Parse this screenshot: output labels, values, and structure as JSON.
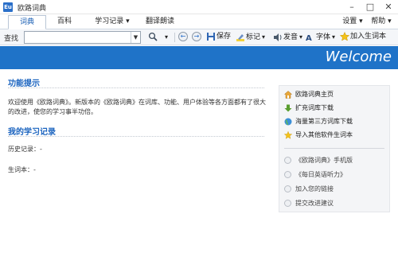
{
  "window": {
    "title": "欧路词典",
    "icon_text": "Eu",
    "min": "–",
    "max": "□",
    "close": "✕"
  },
  "tabs": {
    "dictionary": "词典",
    "encyclopedia": "百科",
    "study_record": "学习记录 ▾",
    "translate": "翻译朗读",
    "settings": "设置 ▾",
    "help": "帮助 ▾"
  },
  "toolbar": {
    "lookup_label": "查找",
    "search_value": "",
    "search_placeholder": "",
    "search_dropdown": "▼",
    "search_icon_dropdown": "▾",
    "back": "←",
    "forward": "→",
    "save": "保存",
    "mark": "标记",
    "mark_dropdown": "▾",
    "pronounce": "发音",
    "pronounce_dropdown": "▾",
    "font": "字体",
    "font_dropdown": "▾",
    "add_vocab": "加入生词本"
  },
  "banner": {
    "text": "Welcome"
  },
  "main": {
    "feature_title": "功能提示",
    "intro_text": "欢迎使用《欧路词典》。新版本的《欧路词典》在词库、功能、用户体验等各方面都有了很大的改进，使您的学习事半功倍。",
    "study_title": "我的学习记录",
    "history_label": "历史记录：-",
    "vocab_label": "生词本：-"
  },
  "side_panel": {
    "links": [
      {
        "label": "欧路词典主页",
        "icon": "home-icon"
      },
      {
        "label": "扩充词库下载",
        "icon": "download-arrow-icon"
      },
      {
        "label": "海量第三方词库下载",
        "icon": "globe-icon"
      },
      {
        "label": "导入其他软件生词本",
        "icon": "star-icon"
      }
    ],
    "items": [
      {
        "label": "《欧路词典》手机版"
      },
      {
        "label": "《每日英语听力》"
      },
      {
        "label": "加入您的链接"
      },
      {
        "label": "提交改进建议"
      }
    ]
  },
  "colors": {
    "banner_blue": "#1f73c8",
    "heading_blue": "#1a63bf",
    "side_panel_bg": "#f4f5f7"
  }
}
